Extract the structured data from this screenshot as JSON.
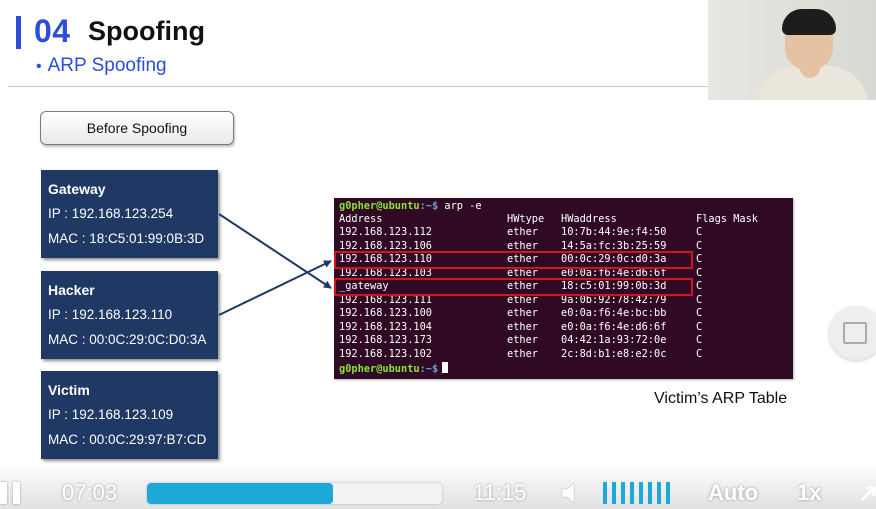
{
  "slide": {
    "section_number": "04",
    "section_title": "Spoofing",
    "subtitle_bullet": "•",
    "subtitle": "ARP Spoofing",
    "before_button_label": "Before Spoofing",
    "hosts": [
      {
        "name": "Gateway",
        "ip": "IP : 192.168.123.254",
        "mac": "MAC : 18:C5:01:99:0B:3D"
      },
      {
        "name": "Hacker",
        "ip": "IP : 192.168.123.110",
        "mac": "MAC : 00:0C:29:0C:D0:3A"
      },
      {
        "name": "Victim",
        "ip": "IP : 192.168.123.109",
        "mac": "MAC : 00:0C:29:97:B7:CD"
      }
    ],
    "caption": "Victim’s ARP Table",
    "accent_color": "#2b4dd8",
    "card_color": "#1f3864",
    "highlight_color": "#d2141c"
  },
  "terminal": {
    "prompt_user": "g0pher@ubuntu",
    "prompt_path": ":~$",
    "command": " arp -e",
    "headers": {
      "address": "Address",
      "hwtype": "HWtype",
      "hwaddress": "HWaddress",
      "flags": "Flags Mask"
    },
    "rows": [
      {
        "address": "192.168.123.112",
        "hwtype": "ether",
        "hwaddress": "10:7b:44:9e:f4:50",
        "flags": "C"
      },
      {
        "address": "192.168.123.106",
        "hwtype": "ether",
        "hwaddress": "14:5a:fc:3b:25:59",
        "flags": "C"
      },
      {
        "address": "192.168.123.110",
        "hwtype": "ether",
        "hwaddress": "00:0c:29:0c:d0:3a",
        "flags": "C"
      },
      {
        "address": "192.168.123.103",
        "hwtype": "ether",
        "hwaddress": "e0:0a:f6:4e:d6:6f",
        "flags": "C"
      },
      {
        "address": "_gateway",
        "hwtype": "ether",
        "hwaddress": "18:c5:01:99:0b:3d",
        "flags": "C"
      },
      {
        "address": "192.168.123.111",
        "hwtype": "ether",
        "hwaddress": "9a:0b:92:78:42:79",
        "flags": "C"
      },
      {
        "address": "192.168.123.100",
        "hwtype": "ether",
        "hwaddress": "e0:0a:f6:4e:bc:bb",
        "flags": "C"
      },
      {
        "address": "192.168.123.104",
        "hwtype": "ether",
        "hwaddress": "e0:0a:f6:4e:d6:6f",
        "flags": "C"
      },
      {
        "address": "192.168.123.173",
        "hwtype": "ether",
        "hwaddress": "04:42:1a:93:72:0e",
        "flags": "C"
      },
      {
        "address": "192.168.123.102",
        "hwtype": "ether",
        "hwaddress": "2c:8d:b1:e8:e2:0c",
        "flags": "C"
      }
    ],
    "highlighted_rows": [
      2,
      4
    ],
    "end_prompt_user": "g0pher@ubuntu",
    "end_prompt_path": ":~$",
    "background": "#300a24"
  },
  "player": {
    "current_time": "07:03",
    "total_time": "11:15",
    "progress_fraction": 0.63,
    "volume_segments": 8,
    "quality_label": "Auto",
    "speed_label": "1x",
    "accent_color": "#1ca9d8"
  }
}
